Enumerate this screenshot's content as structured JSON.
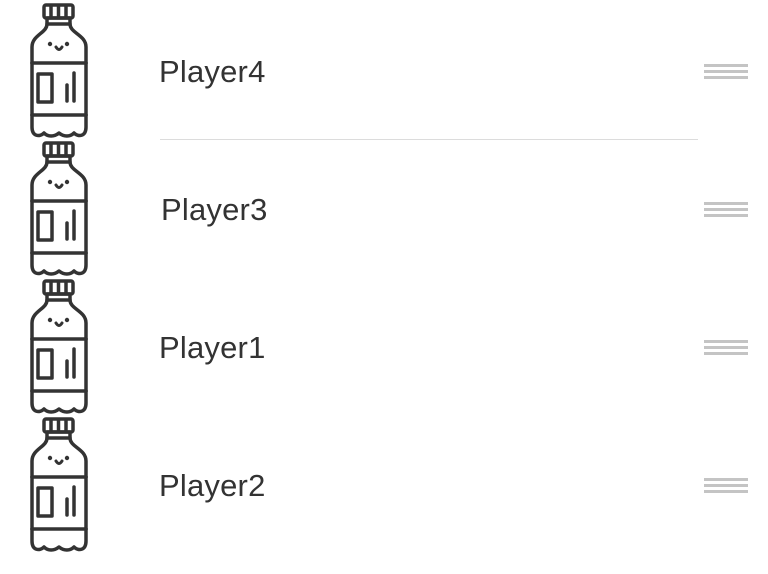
{
  "players": [
    {
      "label": "Player4",
      "icon": "water-bottle-icon"
    },
    {
      "label": "Player3",
      "icon": "water-bottle-icon"
    },
    {
      "label": "Player1",
      "icon": "water-bottle-icon"
    },
    {
      "label": "Player2",
      "icon": "water-bottle-icon"
    }
  ],
  "colors": {
    "text": "#333333",
    "icon_stroke": "#333333",
    "separator": "#dcdcdc",
    "handle": "#c4c4c4"
  }
}
